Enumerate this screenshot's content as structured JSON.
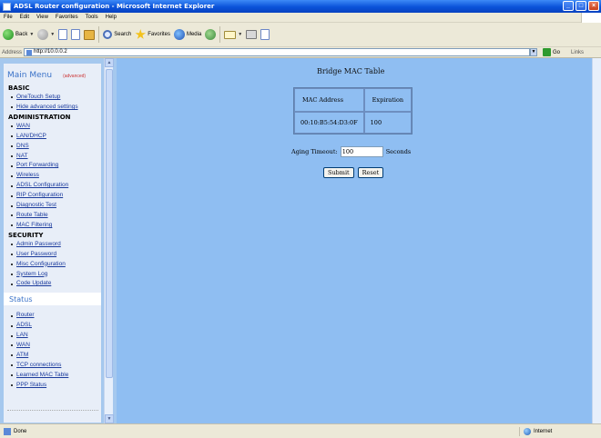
{
  "window": {
    "title": "ADSL Router configuration - Microsoft Internet Explorer"
  },
  "menubar": [
    "File",
    "Edit",
    "View",
    "Favorites",
    "Tools",
    "Help"
  ],
  "toolbar": {
    "back": "Back",
    "search": "Search",
    "favorites": "Favorites",
    "media": "Media"
  },
  "address": {
    "label": "Address",
    "url": "http://10.0.0.2",
    "go": "Go",
    "links": "Links"
  },
  "sidebar": {
    "title": "Main Menu",
    "note": "(advanced)",
    "sections": [
      {
        "heading": "BASIC",
        "items": [
          "OneTouch Setup",
          "Hide advanced settings"
        ]
      },
      {
        "heading": "ADMINISTRATION",
        "items": [
          "WAN",
          "LAN/DHCP",
          "DNS",
          "NAT",
          "Port Forwarding",
          "Wireless",
          "ADSL Configuration",
          "RIP Configuration",
          "Diagnostic Test",
          "Route Table",
          "MAC Filtering"
        ]
      },
      {
        "heading": "SECURITY",
        "items": [
          "Admin Password",
          "User Password",
          "Misc Configuration",
          "System Log",
          "Code Update"
        ]
      }
    ],
    "status_title": "Status",
    "status_items": [
      "Router",
      "ADSL",
      "LAN",
      "WAN",
      "ATM",
      "TCP connections",
      "Learned MAC Table",
      "PPP Status"
    ]
  },
  "main": {
    "title": "Bridge MAC Table",
    "table": {
      "headers": [
        "MAC Address",
        "Expiration"
      ],
      "rows": [
        [
          "00:10:B5:54:D3:0F",
          "100"
        ]
      ]
    },
    "aging_label": "Aging Timeout:",
    "aging_value": "100",
    "aging_unit": "Seconds",
    "submit": "Submit",
    "reset": "Reset"
  },
  "statusbar": {
    "text": "Done",
    "zone": "Internet"
  }
}
